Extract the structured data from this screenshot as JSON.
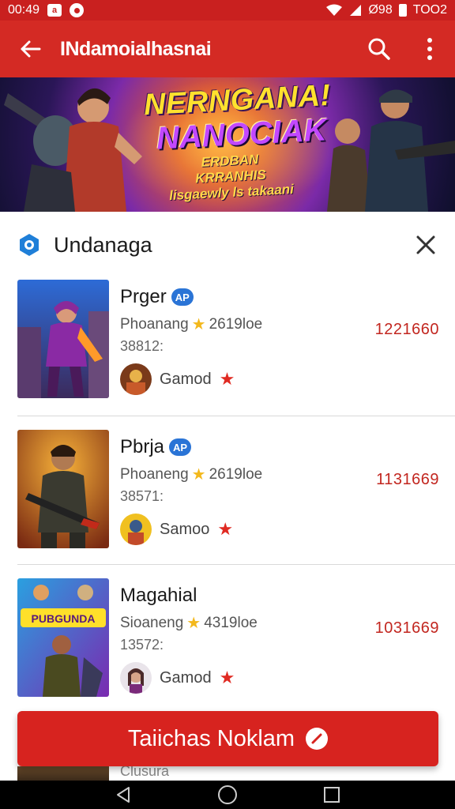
{
  "status_bar": {
    "time": "00:49",
    "left_icons": [
      "a-box-icon",
      "notification-circle-icon"
    ],
    "right_text_1": "Ø98",
    "right_text_2": "TOO2"
  },
  "app_bar": {
    "title": "INdamoialhasnai",
    "back_icon": "arrow-left-icon",
    "search_icon": "search-icon",
    "menu_icon": "more-vertical-icon"
  },
  "banner": {
    "headline_1": "NERNGANA!",
    "headline_2": "NANOCIAK",
    "tagline_1": "ERDBAN KRRANHIS",
    "tagline_2": "lisgaewly ls takaani"
  },
  "section": {
    "title": "Undanaga",
    "icon": "location-pin-icon",
    "close_icon": "close-icon"
  },
  "list": [
    {
      "name": "Prger",
      "badge": "AP",
      "meta_prefix": "Phoanang",
      "meta_value": "2619loe",
      "sub": "38812:",
      "developer": "Gamod",
      "amount": "1221660"
    },
    {
      "name": "Pbrja",
      "badge": "AP",
      "meta_prefix": "Phoaneng",
      "meta_value": "2619loe",
      "sub": "38571:",
      "developer": "Samoo",
      "amount": "1131669"
    },
    {
      "name": "Magahial",
      "badge": "",
      "meta_prefix": "Sioaneng",
      "meta_value": "4319loe",
      "sub": "13572:",
      "developer": "Gamod",
      "amount": "1031669"
    }
  ],
  "thumb_labels": {
    "item3": "PUBGUNDA"
  },
  "cta": {
    "label": "Taiichas Noklam",
    "icon": "no-entry-icon"
  },
  "peek_text": "Clusura",
  "nav": {
    "back": "nav-back-icon",
    "home": "nav-home-icon",
    "recents": "nav-recents-icon"
  },
  "colors": {
    "brand_red": "#d42a24",
    "badge_blue": "#2a74d6",
    "amount_red": "#c2261f",
    "star_gold": "#f3b81c"
  }
}
